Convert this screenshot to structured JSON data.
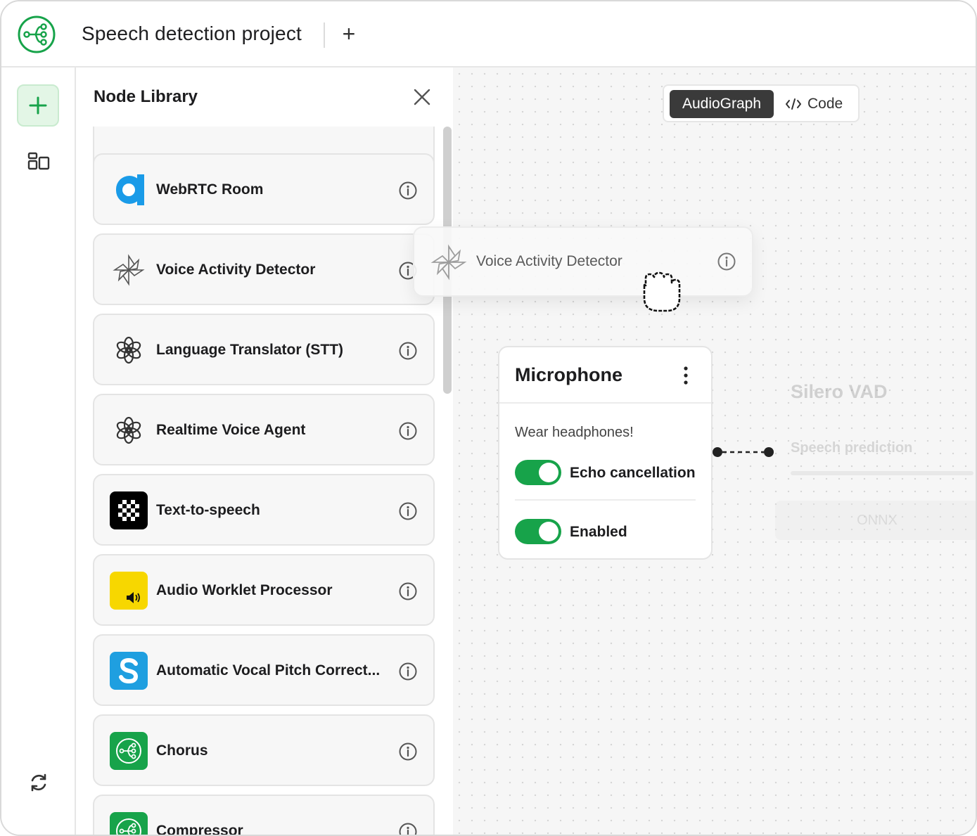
{
  "header": {
    "project_title": "Speech detection project",
    "add_tab_label": "+"
  },
  "rail": {
    "add_icon": "plus-icon",
    "layout_icon": "layout-icon",
    "refresh_icon": "refresh-icon"
  },
  "library": {
    "title": "Node Library",
    "items": [
      {
        "label": "WebRTC Room",
        "icon": "webrtc-icon"
      },
      {
        "label": "Voice Activity Detector",
        "icon": "pinwheel-icon"
      },
      {
        "label": "Language Translator (STT)",
        "icon": "openai-icon"
      },
      {
        "label": "Realtime Voice Agent",
        "icon": "openai-icon"
      },
      {
        "label": "Text-to-speech",
        "icon": "tts-icon"
      },
      {
        "label": "Audio Worklet Processor",
        "icon": "speaker-icon"
      },
      {
        "label": "Automatic Vocal Pitch Correct...",
        "icon": "s-logo-icon"
      },
      {
        "label": "Chorus",
        "icon": "graph-icon"
      },
      {
        "label": "Compressor",
        "icon": "graph-icon"
      }
    ]
  },
  "canvas": {
    "view_toggle": {
      "active": "AudioGraph",
      "code": "Code"
    },
    "dragged_node": {
      "label": "Voice Activity Detector"
    },
    "microphone_node": {
      "title": "Microphone",
      "hint": "Wear headphones!",
      "toggles": [
        {
          "label": "Echo cancellation",
          "on": true
        },
        {
          "label": "Enabled",
          "on": true
        }
      ]
    },
    "vad_node": {
      "title": "Silero VAD",
      "output_label": "Speech prediction",
      "button": "ONNX"
    }
  },
  "colors": {
    "brand_green": "#17a34a",
    "toggle_on": "#17a34a",
    "segment_active": "#3a3a3a"
  }
}
